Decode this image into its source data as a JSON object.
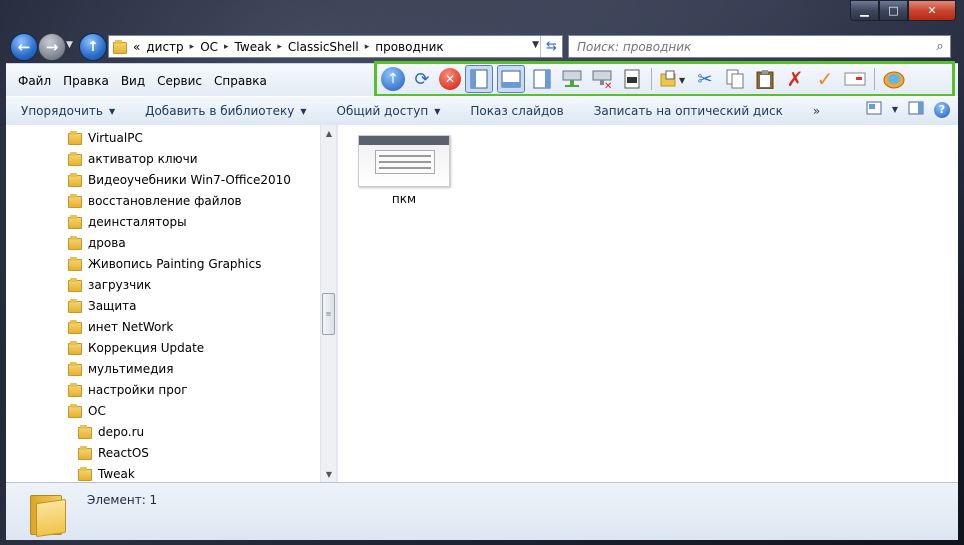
{
  "window": {
    "caption": {
      "minimize": "▁",
      "maximize": "□",
      "close": "✕"
    }
  },
  "nav": {
    "back_icon": "back-arrow-icon",
    "forward_icon": "forward-arrow-icon",
    "up_icon": "up-arrow-icon"
  },
  "address": {
    "overflow": "«",
    "crumbs": [
      "дистр",
      "ОС",
      "Tweak",
      "ClassicShell",
      "проводник"
    ],
    "separator": "▸"
  },
  "search": {
    "placeholder": "Поиск: проводник"
  },
  "menu": {
    "items": [
      "Файл",
      "Правка",
      "Вид",
      "Сервис",
      "Справка"
    ]
  },
  "classic_toolbar": {
    "highlight_color": "#57c12a",
    "buttons": [
      "up-one-level-icon",
      "refresh-icon",
      "stop-icon",
      "nav-pane-icon",
      "details-pane-icon",
      "preview-pane-icon",
      "map-drive-icon",
      "disconnect-drive-icon",
      "properties-icon",
      "folder-options-icon",
      "cut-icon",
      "copy-icon",
      "paste-icon",
      "delete-icon",
      "checkmark-icon",
      "email-icon",
      "classic-shell-settings-icon"
    ]
  },
  "commands": {
    "organize": "Упорядочить",
    "add_to_library": "Добавить в библиотеку",
    "share": "Общий доступ",
    "slideshow": "Показ слайдов",
    "burn": "Записать на оптический диск",
    "more": "»"
  },
  "tree": {
    "items": [
      {
        "label": "VirtualPC",
        "level": 0
      },
      {
        "label": "активатор ключи",
        "level": 0
      },
      {
        "label": "Видеоучебники Win7-Office2010",
        "level": 0
      },
      {
        "label": "восстановление файлов",
        "level": 0
      },
      {
        "label": "деинсталяторы",
        "level": 0
      },
      {
        "label": "дрова",
        "level": 0
      },
      {
        "label": "Живопись Painting Graphics",
        "level": 0
      },
      {
        "label": "загрузчик",
        "level": 0
      },
      {
        "label": "Защита",
        "level": 0
      },
      {
        "label": "инет NetWork",
        "level": 0
      },
      {
        "label": "Коррекция Update",
        "level": 0
      },
      {
        "label": "мультимедия",
        "level": 0
      },
      {
        "label": "настройки прог",
        "level": 0
      },
      {
        "label": "ОС",
        "level": 0
      },
      {
        "label": "depo.ru",
        "level": 1
      },
      {
        "label": "ReactOS",
        "level": 1
      },
      {
        "label": "Tweak",
        "level": 1
      }
    ]
  },
  "files": [
    {
      "name": "пкм"
    }
  ],
  "status": {
    "text": "Элемент: 1"
  }
}
